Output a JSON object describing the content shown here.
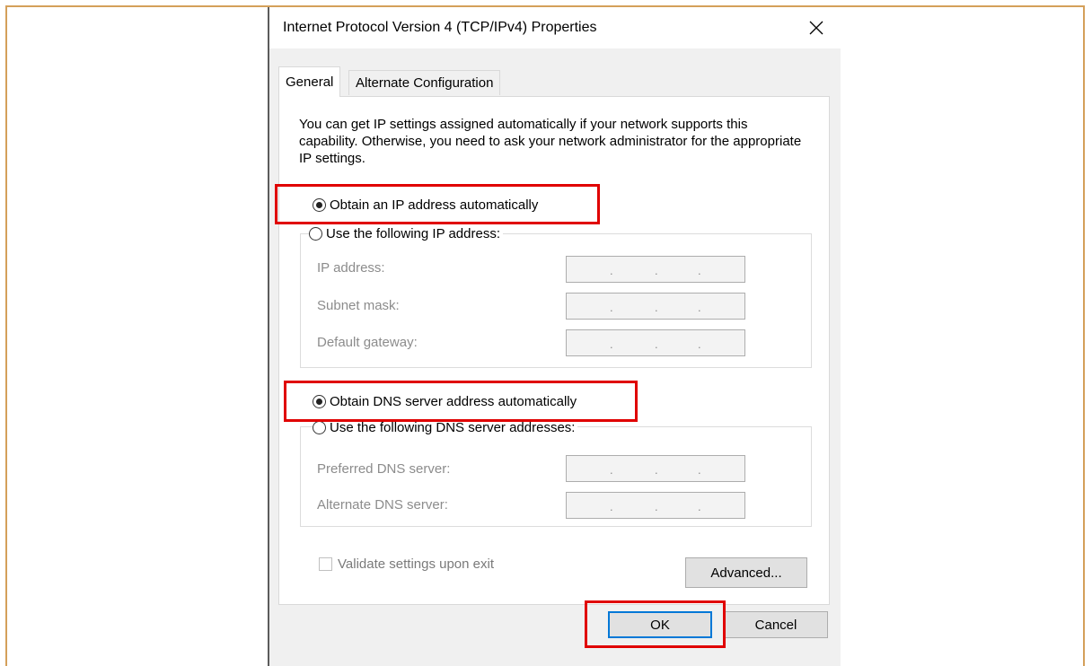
{
  "dialog": {
    "title": "Internet Protocol Version 4 (TCP/IPv4) Properties",
    "tabs": [
      {
        "label": "General",
        "active": true
      },
      {
        "label": "Alternate Configuration",
        "active": false
      }
    ],
    "intro_text": "You can get IP settings assigned automatically if your network supports this capability. Otherwise, you need to ask your network administrator for the appropriate IP settings.",
    "ip_section": {
      "auto_label": "Obtain an IP address automatically",
      "auto_selected": true,
      "manual_label": "Use the following IP address:",
      "fields": [
        {
          "label": "IP address:",
          "value": ". . ."
        },
        {
          "label": "Subnet mask:",
          "value": ". . ."
        },
        {
          "label": "Default gateway:",
          "value": ". . ."
        }
      ]
    },
    "dns_section": {
      "auto_label": "Obtain DNS server address automatically",
      "auto_selected": true,
      "manual_label": "Use the following DNS server addresses:",
      "fields": [
        {
          "label": "Preferred DNS server:",
          "value": ". . ."
        },
        {
          "label": "Alternate DNS server:",
          "value": ". . ."
        }
      ]
    },
    "validate_label": "Validate settings upon exit",
    "validate_checked": false,
    "advanced_label": "Advanced...",
    "ok_label": "OK",
    "cancel_label": "Cancel"
  },
  "icons": {
    "close": "close-icon"
  },
  "colors": {
    "highlight": "#e00000",
    "accent": "#0078d7",
    "frame": "#d4a05a"
  }
}
